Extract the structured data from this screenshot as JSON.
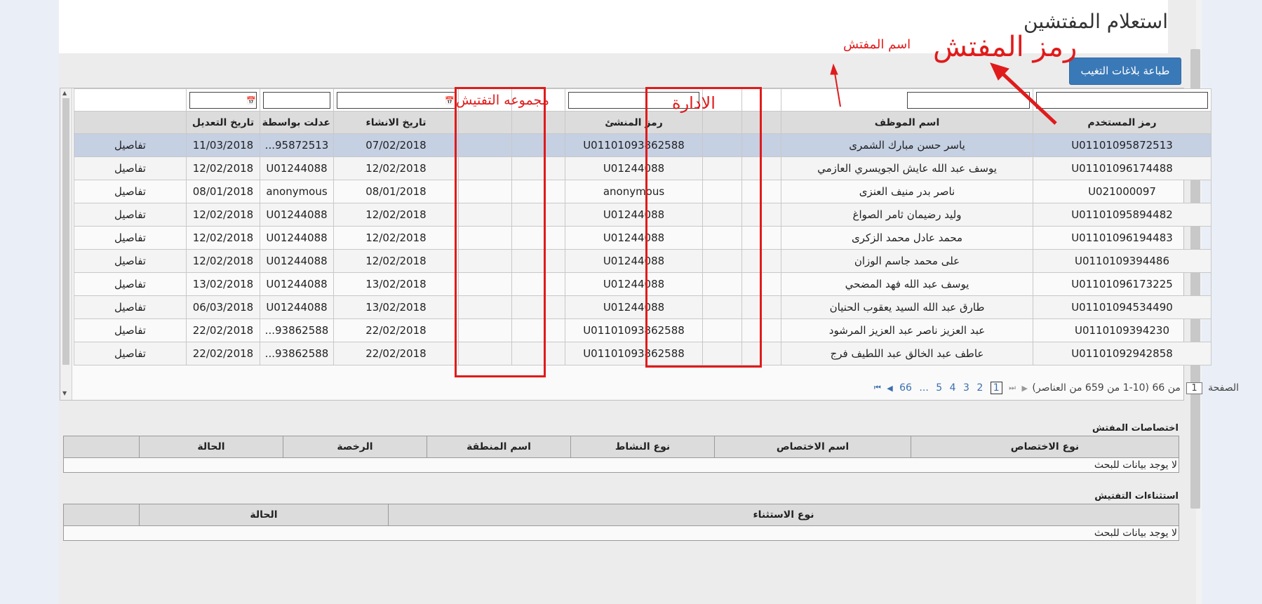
{
  "page": {
    "title": "استعلام المفتشين",
    "print_button": "طباعة بلاغات التغيب"
  },
  "grid": {
    "headers": {
      "user_code": "رمز المستخدم",
      "employee_name": "اسم الموظف",
      "creator_code": "رمز المنشئ",
      "created_date": "تاريخ الانشاء",
      "modified_by": "عدلت بواسطة",
      "modified_date": "تاريخ التعديل"
    },
    "details_label": "تفاصيل",
    "rows": [
      {
        "user_code": "U01101095872513",
        "name": "ياسر حسن مبارك الشمرى",
        "creator": "U01101093862588",
        "created": "07/02/2018",
        "modified_by": "...95872513",
        "modified": "11/03/2018"
      },
      {
        "user_code": "U01101096174488",
        "name": "يوسف عبد الله عايش الجويسري العازمي",
        "creator": "U01244088",
        "created": "12/02/2018",
        "modified_by": "U01244088",
        "modified": "12/02/2018"
      },
      {
        "user_code": "U021000097",
        "name": "ناصر بدر منيف العنزى",
        "creator": "anonymous",
        "created": "08/01/2018",
        "modified_by": "anonymous",
        "modified": "08/01/2018"
      },
      {
        "user_code": "U01101095894482",
        "name": "وليد رضيمان ثامر الصواغ",
        "creator": "U01244088",
        "created": "12/02/2018",
        "modified_by": "U01244088",
        "modified": "12/02/2018"
      },
      {
        "user_code": "U01101096194483",
        "name": "محمد عادل محمد الزكرى",
        "creator": "U01244088",
        "created": "12/02/2018",
        "modified_by": "U01244088",
        "modified": "12/02/2018"
      },
      {
        "user_code": "U0110109394486",
        "name": "على محمد جاسم الوزان",
        "creator": "U01244088",
        "created": "12/02/2018",
        "modified_by": "U01244088",
        "modified": "12/02/2018"
      },
      {
        "user_code": "U01101096173225",
        "name": "يوسف عبد الله فهد المضحي",
        "creator": "U01244088",
        "created": "13/02/2018",
        "modified_by": "U01244088",
        "modified": "13/02/2018"
      },
      {
        "user_code": "U01101094534490",
        "name": "طارق عبد الله السيد يعقوب الحنيان",
        "creator": "U01244088",
        "created": "13/02/2018",
        "modified_by": "U01244088",
        "modified": "06/03/2018"
      },
      {
        "user_code": "U0110109394230",
        "name": "عبد العزيز ناصر عبد العزيز المرشود",
        "creator": "U01101093862588",
        "created": "22/02/2018",
        "modified_by": "...93862588",
        "modified": "22/02/2018"
      },
      {
        "user_code": "U01101092942858",
        "name": "عاطف عبد الخالق عبد اللطيف فرج",
        "creator": "U01101093862588",
        "created": "22/02/2018",
        "modified_by": "...93862588",
        "modified": "22/02/2018"
      }
    ]
  },
  "pager": {
    "page_label": "الصفحة",
    "current_page": "1",
    "summary": "من 66 (10-1 من 659 من العناصر)",
    "pages": [
      "1",
      "2",
      "3",
      "4",
      "5"
    ],
    "ellipsis": "...",
    "last_page": "66"
  },
  "specialties": {
    "title": "اختصاصات المفتش",
    "headers": [
      "نوع الاختصاص",
      "اسم الاختصاص",
      "نوع النشاط",
      "اسم المنطقة",
      "الرخصة",
      "الحالة"
    ],
    "empty": "لا يوجد بيانات للبحث"
  },
  "exceptions": {
    "title": "استثناءات التفتيش",
    "headers": [
      "نوع الاستثناء",
      "الحالة"
    ],
    "empty": "لا يوجد بيانات للبحث"
  },
  "annotations": {
    "inspector_code": "رمز المفتش",
    "inspector_name": "اسم المفتش",
    "administration": "الادارة",
    "inspection_group": "مجموعه التفتيش",
    "color": "#e01b1b"
  },
  "colors": {
    "accent": "#3a79b7",
    "selected_row": "#c5d0e3",
    "link": "#3a6fb0"
  }
}
